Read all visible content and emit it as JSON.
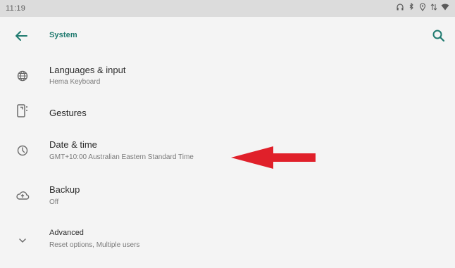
{
  "status_bar": {
    "time": "11:19",
    "icons": [
      "headphones-icon",
      "bluetooth-icon",
      "location-icon",
      "data-icon",
      "wifi-icon"
    ]
  },
  "app_bar": {
    "title": "System",
    "back_icon": "arrow-left-icon",
    "search_icon": "search-icon",
    "accent_color": "#1f7a6f"
  },
  "items": [
    {
      "title": "Languages & input",
      "subtitle": "Hema Keyboard",
      "icon": "globe-icon"
    },
    {
      "title": "Gestures",
      "subtitle": "",
      "icon": "phone-gesture-icon"
    },
    {
      "title": "Date & time",
      "subtitle": "GMT+10:00 Australian Eastern Standard Time",
      "icon": "clock-icon"
    },
    {
      "title": "Backup",
      "subtitle": "Off",
      "icon": "cloud-backup-icon"
    },
    {
      "title": "Advanced",
      "subtitle": "Reset options, Multiple users",
      "icon": "chevron-down-icon"
    }
  ],
  "annotation": {
    "type": "arrow",
    "color": "#e0202a",
    "target": "Date & time"
  }
}
